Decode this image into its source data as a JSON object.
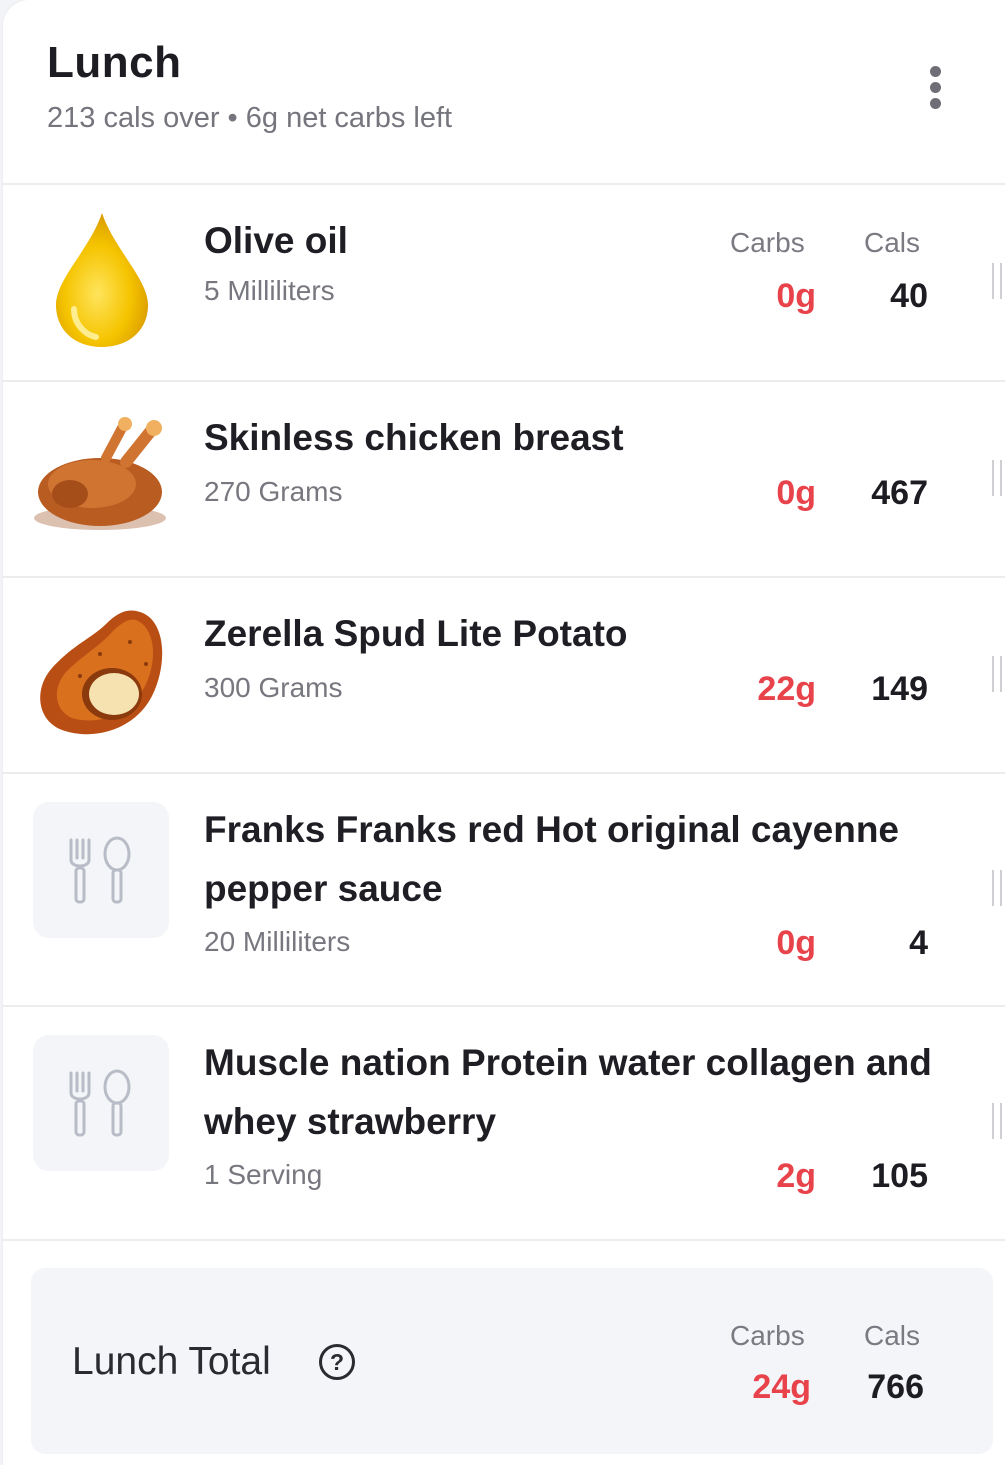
{
  "meal": {
    "title": "Lunch",
    "summary": "213 cals over • 6g net carbs left"
  },
  "columns": {
    "carbs": "Carbs",
    "cals": "Cals"
  },
  "items": [
    {
      "name": "Olive oil",
      "quantity": "5 Milliliters",
      "carbs": "0g",
      "cals": "40",
      "icon": "olive-oil-drop-icon"
    },
    {
      "name": "Skinless chicken breast",
      "quantity": "270 Grams",
      "carbs": "0g",
      "cals": "467",
      "icon": "roast-chicken-icon"
    },
    {
      "name": "Zerella Spud Lite Potato",
      "quantity": "300 Grams",
      "carbs": "22g",
      "cals": "149",
      "icon": "potato-icon"
    },
    {
      "name": "Franks Franks red Hot original cayenne pepper sauce",
      "quantity": "20 Milliliters",
      "carbs": "0g",
      "cals": "4",
      "icon": "fork-spoon-icon"
    },
    {
      "name": "Muscle nation Protein water collagen and whey strawberry",
      "quantity": "1 Serving",
      "carbs": "2g",
      "cals": "105",
      "icon": "fork-spoon-icon"
    }
  ],
  "total": {
    "label": "Lunch Total",
    "carbs": "24g",
    "cals": "766",
    "help_icon": "question-circle-icon"
  },
  "colors": {
    "carbs": "#e8434b",
    "text": "#1c1c22",
    "muted": "#75757d"
  }
}
